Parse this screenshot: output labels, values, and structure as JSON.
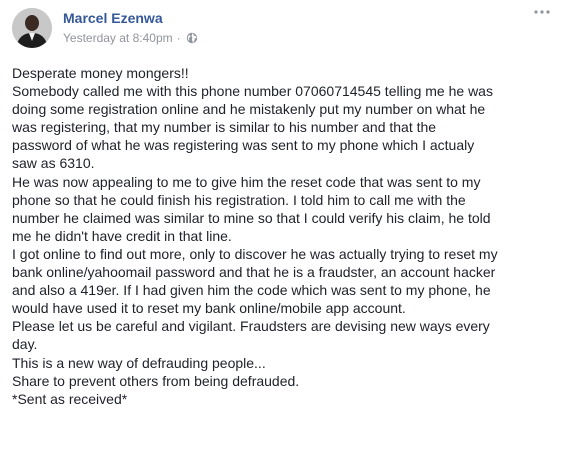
{
  "author": {
    "name": "Marcel Ezenwa",
    "avatar_icon": "profile-photo-icon"
  },
  "meta": {
    "timestamp": "Yesterday at 8:40pm",
    "separator": "·",
    "privacy_icon": "globe-icon"
  },
  "menu": {
    "icon": "more-options-icon"
  },
  "colors": {
    "author_link": "#365899",
    "meta_text": "#90949c",
    "body_text": "#1d2129",
    "background": "#ffffff"
  },
  "post": {
    "lines": [
      "Desperate money mongers!!",
      "Somebody called me with this phone number 07060714545 telling me he was",
      "doing some registration online and he mistakenly put my number on what he",
      "was registering, that my number is similar to his number and that the",
      "password of what he was registering was sent to my phone which I actualy",
      "saw as 6310.",
      "He was now appealing to me to give him the reset code that was sent to my",
      "phone so that he could finish his registration. I told him to call me with the",
      "number he claimed was similar to mine so that I could verify his claim, he told",
      "me he didn't have credit in that line.",
      "I got online to find out more, only to discover he was actually trying to reset my",
      "bank online/yahoomail password and that he is a fraudster, an account hacker",
      "and also a 419er. If I had given him the code which was sent to my phone, he",
      "would have used it to reset my bank online/mobile app account.",
      "Please let us be careful and vigilant. Fraudsters are devising new ways every",
      "day.",
      "This is a new way of defrauding people...",
      "Share to prevent others from being defrauded.",
      "*Sent as received*"
    ]
  }
}
